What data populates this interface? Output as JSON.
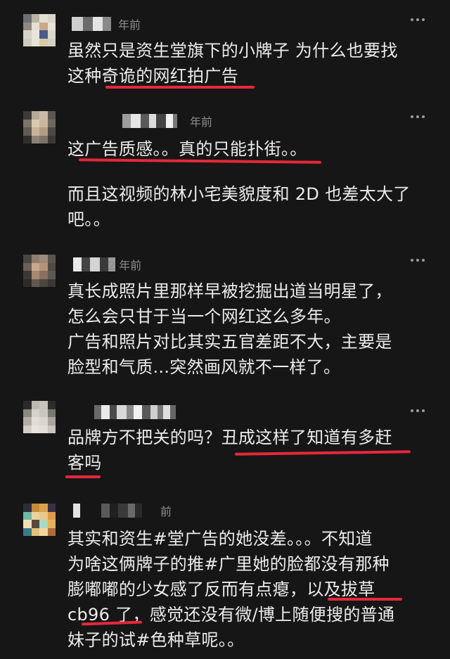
{
  "comments": [
    {
      "time": "年前",
      "lines": [
        "虽然只是资生堂旗下的小牌子 为什么也要找",
        "这种奇诡的网红拍广告"
      ]
    },
    {
      "time": "年前",
      "lines": [
        "这广告质感。。真的只能扑街。。",
        "",
        "而且这视频的林小宅美貌度和 2D 也差太大了",
        "吧。。"
      ]
    },
    {
      "time": "2 年前",
      "lines": [
        "真长成照片里那样早被挖掘出道当明星了，",
        "怎么会只甘于当一个网红这么多年。",
        "广告和照片对比其实五官差距不大，主要是",
        "脸型和气质...突然画风就不一样了。"
      ]
    },
    {
      "time": "",
      "lines": [
        "品牌方不把关的吗？丑成这样了知道有多赶",
        "客吗"
      ]
    },
    {
      "time": "前",
      "lines": [
        "其实和资生#堂广告的她没差。。。不知道",
        "为啥这俩牌子的推#广里她的脸都没有那种",
        "膨嘟嘟的少女感了反而有点瘪，以及拔草",
        "cb96 了，感觉还没有微/博上随便搜的普通",
        "妹子的试#色种草呢。。"
      ]
    }
  ],
  "icons": [
    "more-icon"
  ],
  "colors": {
    "background": "#161617",
    "text": "#ececec",
    "meta": "#8d8d8d",
    "underline": "#e6283a"
  }
}
